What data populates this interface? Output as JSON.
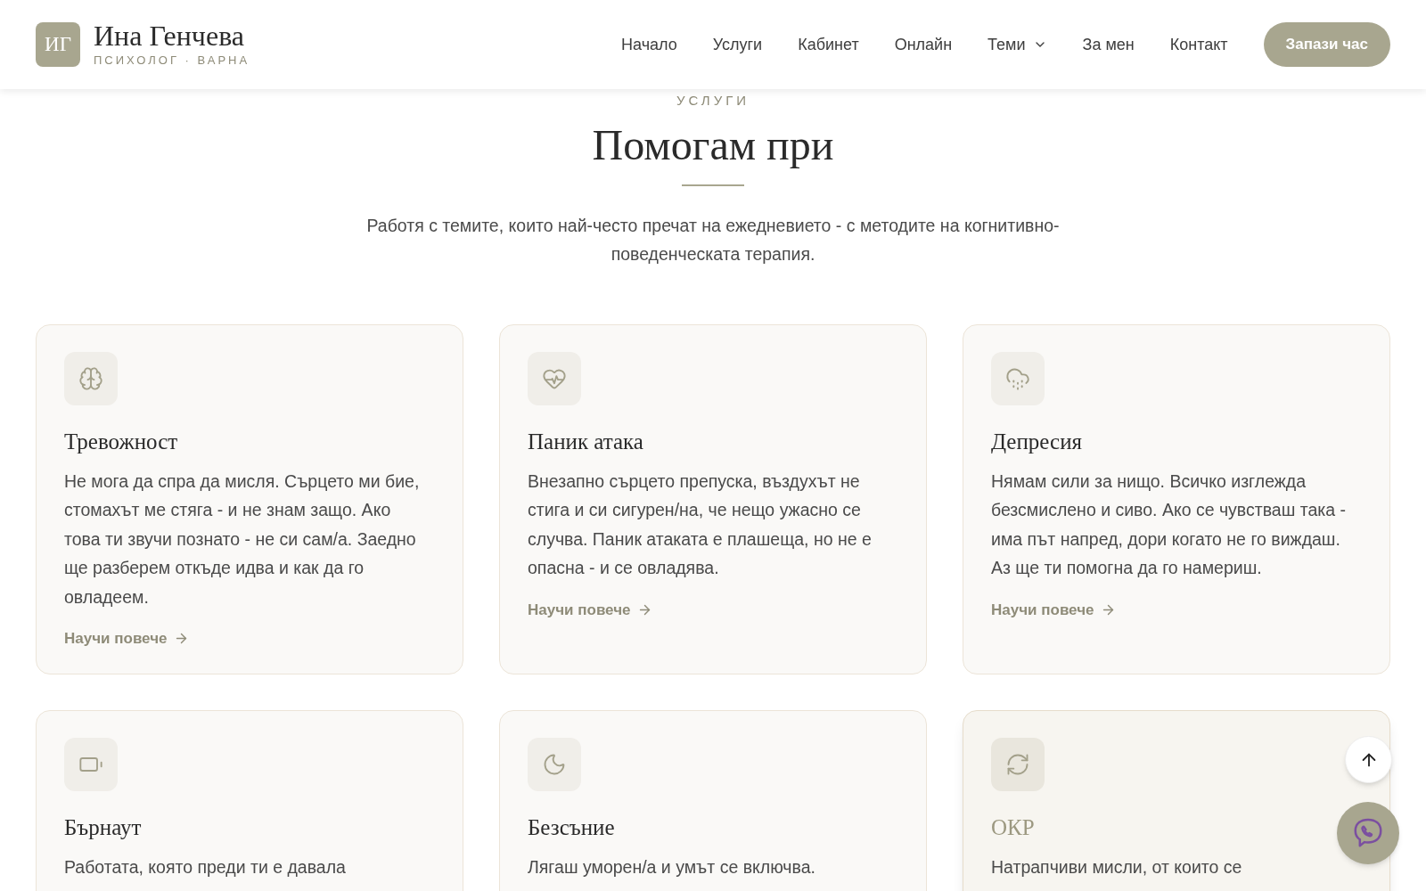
{
  "header": {
    "logo_initials": "ИГ",
    "name": "Ина Генчева",
    "tagline": "ПСИХОЛОГ · ВАРНА",
    "nav": [
      {
        "label": "Начало",
        "dropdown": false
      },
      {
        "label": "Услуги",
        "dropdown": false
      },
      {
        "label": "Кабинет",
        "dropdown": false
      },
      {
        "label": "Онлайн",
        "dropdown": false
      },
      {
        "label": "Теми",
        "dropdown": true
      },
      {
        "label": "За мен",
        "dropdown": false
      },
      {
        "label": "Контакт",
        "dropdown": false
      }
    ],
    "cta": "Запази час"
  },
  "section": {
    "eyebrow": "УСЛУГИ",
    "title": "Помогам при",
    "intro": "Работя с темите, които най-често пречат на ежедневието - с методите на когнитивно-поведенческата терапия."
  },
  "cards": [
    {
      "title": "Тревожност",
      "hovered": false,
      "text": "Не мога да спра да мисля. Сърцето ми бие, стомахът ме стяга - и не знам защо. Ако това ти звучи познато - не си сам/а. Заедно ще разберем откъде идва и как да го овладеем.",
      "link": "Научи повече"
    },
    {
      "title": "Паник атака",
      "hovered": false,
      "text": "Внезапно сърцето препуска, въздухът не стига и си сигурен/на, че нещо ужасно се случва. Паник атаката е плашеща, но не е опасна - и се овладява.",
      "link": "Научи повече"
    },
    {
      "title": "Депресия",
      "hovered": false,
      "text": "Нямам сили за нищо. Всичко изглежда безсмислено и сиво. Ако се чувстваш така - има път напред, дори когато не го виждаш. Аз ще ти помогна да го намериш.",
      "link": "Научи повече"
    },
    {
      "title": "Бърнаут",
      "hovered": false,
      "text": "Работата, която преди ти е давала"
    },
    {
      "title": "Безсъние",
      "hovered": false,
      "text": "Лягаш уморен/а и умът се включва."
    },
    {
      "title": "ОКР",
      "hovered": true,
      "text": "Натрапчиви мисли, от които се"
    }
  ]
}
